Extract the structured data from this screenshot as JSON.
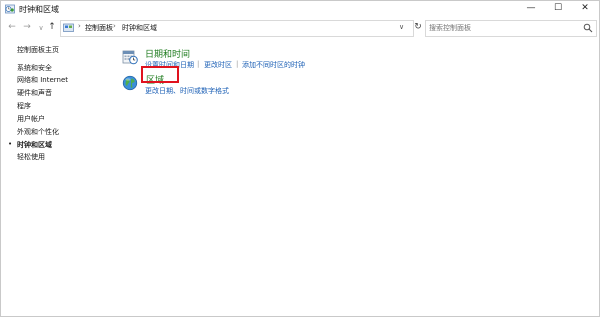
{
  "window": {
    "title": "时钟和区域",
    "icons": {
      "app": "clock-region-icon",
      "minimize": "minimize-icon",
      "maximize": "maximize-icon",
      "close": "close-icon"
    },
    "minimize_glyph": "—",
    "maximize_glyph": "☐",
    "close_glyph": "✕"
  },
  "nav": {
    "back_glyph": "←",
    "forward_glyph": "→",
    "recent_glyph": "∨",
    "up_glyph": "↑",
    "breadcrumbs": [
      "控制面板",
      "时钟和区域"
    ],
    "separator": "›",
    "dropdown_glyph": "∨",
    "refresh_glyph": "↻",
    "search_placeholder": "搜索控制面板",
    "search_icon": "search-icon"
  },
  "sidebar": {
    "items": [
      {
        "label": "控制面板主页",
        "current": false
      },
      {
        "label": "系统和安全",
        "current": false
      },
      {
        "label": "网络和 Internet",
        "current": false
      },
      {
        "label": "硬件和声音",
        "current": false
      },
      {
        "label": "程序",
        "current": false
      },
      {
        "label": "用户帐户",
        "current": false
      },
      {
        "label": "外观和个性化",
        "current": false
      },
      {
        "label": "时钟和区域",
        "current": true
      },
      {
        "label": "轻松使用",
        "current": false
      }
    ],
    "current_marker": "•"
  },
  "main": {
    "categories": [
      {
        "title": "日期和时间",
        "icon": "date-time-icon",
        "tasks": [
          "设置时间和日期",
          "更改时区",
          "添加不同时区的时钟"
        ]
      },
      {
        "title": "区域",
        "icon": "region-globe-icon",
        "tasks": [
          "更改日期、时间或数字格式"
        ]
      }
    ],
    "task_separator": "|"
  },
  "colors": {
    "category_title": "#1e7b1e",
    "task_link": "#1b5fb5",
    "highlight": "#e0121e"
  }
}
